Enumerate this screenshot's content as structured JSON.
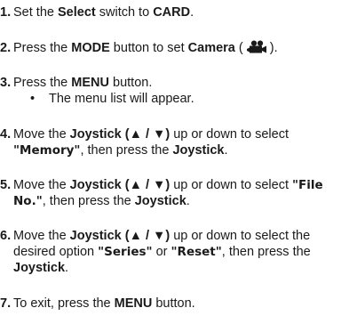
{
  "steps": [
    {
      "n": "1.",
      "p": [
        {
          "t": "Set the ",
          "b": false
        },
        {
          "t": "Select",
          "b": true
        },
        {
          "t": " switch to ",
          "b": false
        },
        {
          "t": "CARD",
          "b": true
        },
        {
          "t": ".",
          "b": false
        }
      ]
    },
    {
      "n": "2.",
      "p": [
        {
          "t": "Press the ",
          "b": false
        },
        {
          "t": "MODE",
          "b": true
        },
        {
          "t": " button to set ",
          "b": false
        },
        {
          "t": "Camera",
          "b": true
        },
        {
          "t": " ( ",
          "b": false
        },
        {
          "icon": "camera-icon"
        },
        {
          "t": " ).",
          "b": false
        }
      ]
    },
    {
      "n": "3.",
      "p": [
        {
          "t": "Press the ",
          "b": false
        },
        {
          "t": "MENU",
          "b": true
        },
        {
          "t": " button.",
          "b": false
        }
      ],
      "sub": "The menu list will appear."
    },
    {
      "n": "4.",
      "p": [
        {
          "t": "Move the ",
          "b": false
        },
        {
          "t": "Joystick (▲ / ▼)",
          "b": true
        },
        {
          "t": " up or down to select ",
          "b": false
        },
        {
          "t": "\"Memory\"",
          "b": true,
          "q": true
        },
        {
          "t": ", then press the ",
          "b": false
        },
        {
          "t": "Joystick",
          "b": true
        },
        {
          "t": ".",
          "b": false
        }
      ]
    },
    {
      "n": "5.",
      "p": [
        {
          "t": "Move the ",
          "b": false
        },
        {
          "t": "Joystick (▲ / ▼)",
          "b": true
        },
        {
          "t": " up or down to select ",
          "b": false
        },
        {
          "t": "\"File No.\"",
          "b": true,
          "q": true
        },
        {
          "t": ", then press the ",
          "b": false
        },
        {
          "t": "Joystick",
          "b": true
        },
        {
          "t": ".",
          "b": false
        }
      ]
    },
    {
      "n": "6.",
      "p": [
        {
          "t": "Move the ",
          "b": false
        },
        {
          "t": "Joystick (▲ / ▼)",
          "b": true
        },
        {
          "t": " up or down to select the desired option ",
          "b": false
        },
        {
          "t": "\"Series\"",
          "b": true,
          "q": true
        },
        {
          "t": " or ",
          "b": false
        },
        {
          "t": "\"Reset\"",
          "b": true,
          "q": true
        },
        {
          "t": ", then press the ",
          "b": false
        },
        {
          "t": "Joystick",
          "b": true
        },
        {
          "t": ".",
          "b": false
        }
      ]
    },
    {
      "n": "7.",
      "p": [
        {
          "t": "To exit, press the ",
          "b": false
        },
        {
          "t": "MENU",
          "b": true
        },
        {
          "t": " button.",
          "b": false
        }
      ]
    }
  ],
  "bullet": "•"
}
